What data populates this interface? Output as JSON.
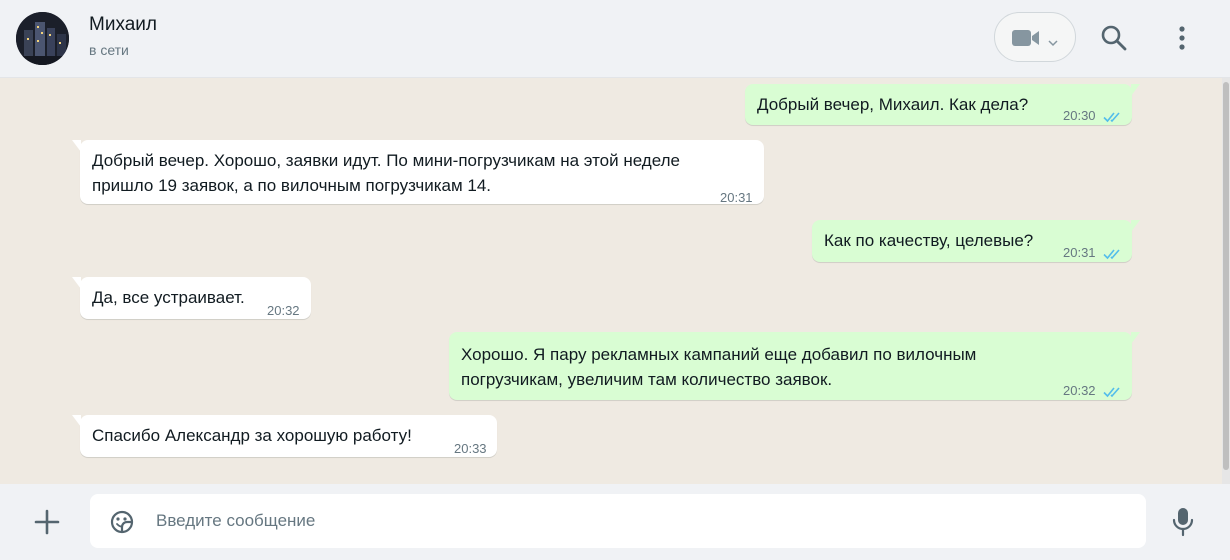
{
  "contact": {
    "name": "Михаил",
    "status": "в сети"
  },
  "header_icons": {
    "video": "video-camera-icon",
    "search": "search-icon",
    "menu": "menu-dots-icon"
  },
  "colors": {
    "outgoing_bubble": "#d9fdd3",
    "incoming_bubble": "#ffffff",
    "read_ticks": "#53bdeb",
    "chat_background": "#efeae2"
  },
  "messages": [
    {
      "direction": "outgoing",
      "lines": [
        "Добрый вечер, Михаил. Как дела?"
      ],
      "time": "20:30",
      "status": "read"
    },
    {
      "direction": "incoming",
      "lines": [
        "Добрый вечер. Хорошо, заявки идут. По мини-погрузчикам на этой неделе",
        "пришло 19 заявок, а по вилочным погрузчикам 14."
      ],
      "time": "20:31"
    },
    {
      "direction": "outgoing",
      "lines": [
        "Как по качеству, целевые?"
      ],
      "time": "20:31",
      "status": "read"
    },
    {
      "direction": "incoming",
      "lines": [
        "Да, все устраивает."
      ],
      "time": "20:32"
    },
    {
      "direction": "outgoing",
      "lines": [
        "Хорошо. Я пару рекламных кампаний еще добавил по вилочным",
        "погрузчикам, увеличим там количество заявок."
      ],
      "time": "20:32",
      "status": "read"
    },
    {
      "direction": "incoming",
      "lines": [
        "Спасибо Александр за хорошую работу!"
      ],
      "time": "20:33"
    }
  ],
  "composer": {
    "placeholder": "Введите сообщение",
    "value": "",
    "icons": {
      "attach": "plus-icon",
      "sticker": "sticker-icon",
      "voice": "microphone-icon"
    }
  }
}
